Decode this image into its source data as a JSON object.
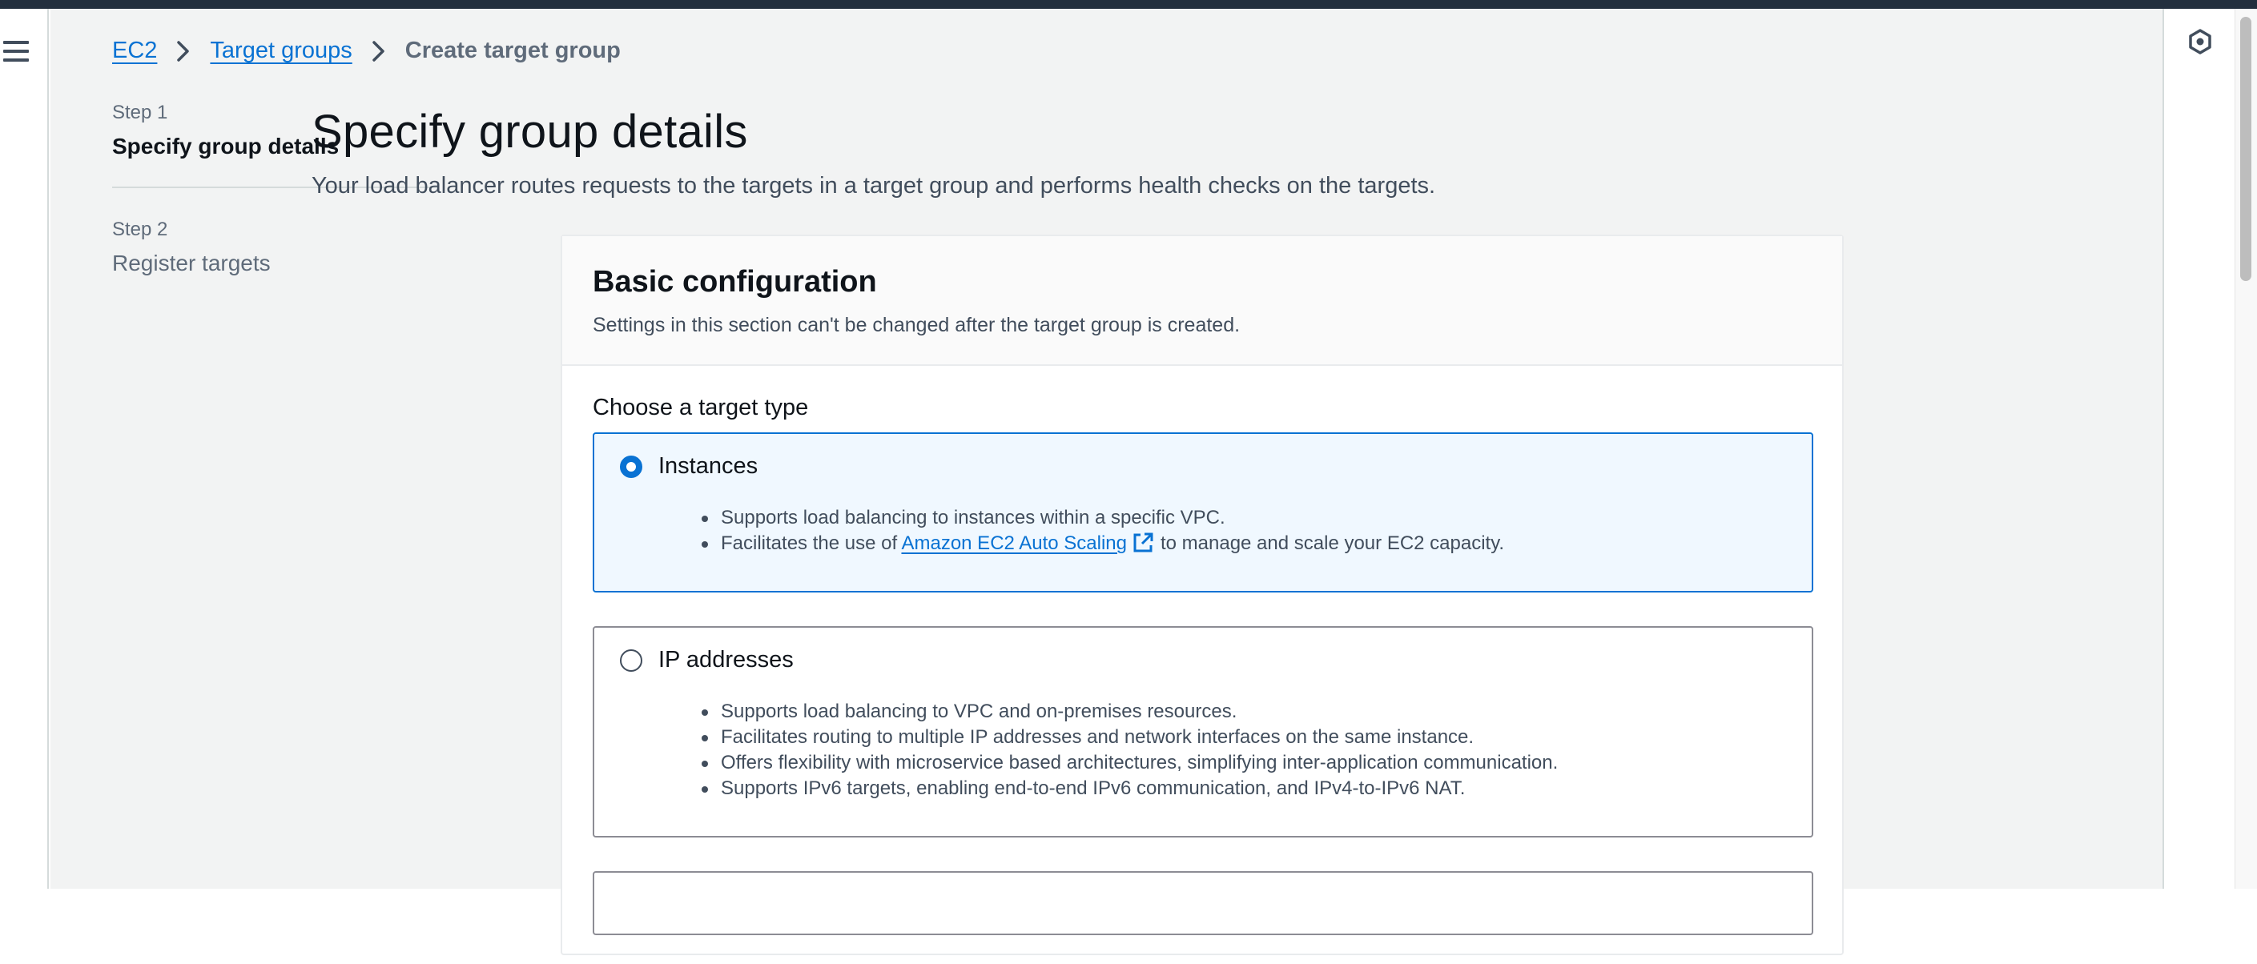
{
  "breadcrumb": {
    "items": [
      "EC2",
      "Target groups"
    ],
    "current": "Create target group"
  },
  "steps": [
    {
      "label": "Step 1",
      "title": "Specify group details",
      "active": true
    },
    {
      "label": "Step 2",
      "title": "Register targets",
      "active": false
    }
  ],
  "page": {
    "title": "Specify group details",
    "description": "Your load balancer routes requests to the targets in a target group and performs health checks on the targets."
  },
  "basic_config": {
    "title": "Basic configuration",
    "description": "Settings in this section can't be changed after the target group is created.",
    "target_type_label": "Choose a target type",
    "options": [
      {
        "title": "Instances",
        "selected": true,
        "bullets": [
          "Supports load balancing to instances within a specific VPC."
        ],
        "link_bullet": {
          "prefix": "Facilitates the use of",
          "link": "Amazon EC2 Auto Scaling",
          "suffix": "to manage and scale your EC2 capacity."
        }
      },
      {
        "title": "IP addresses",
        "selected": false,
        "bullets": [
          "Supports load balancing to VPC and on-premises resources.",
          "Facilitates routing to multiple IP addresses and network interfaces on the same instance.",
          "Offers flexibility with microservice based architectures, simplifying inter-application communication.",
          "Supports IPv6 targets, enabling end-to-end IPv6 communication, and IPv4-to-IPv6 NAT."
        ]
      }
    ]
  },
  "colors": {
    "accent": "#0972d3",
    "topbar": "#232f3e",
    "page_bg": "#f2f3f3",
    "selected_tile_bg": "#f0f8ff"
  },
  "icons": [
    "menu-icon",
    "chevron-right-icon",
    "external-link-icon",
    "hexagon-help-icon"
  ]
}
